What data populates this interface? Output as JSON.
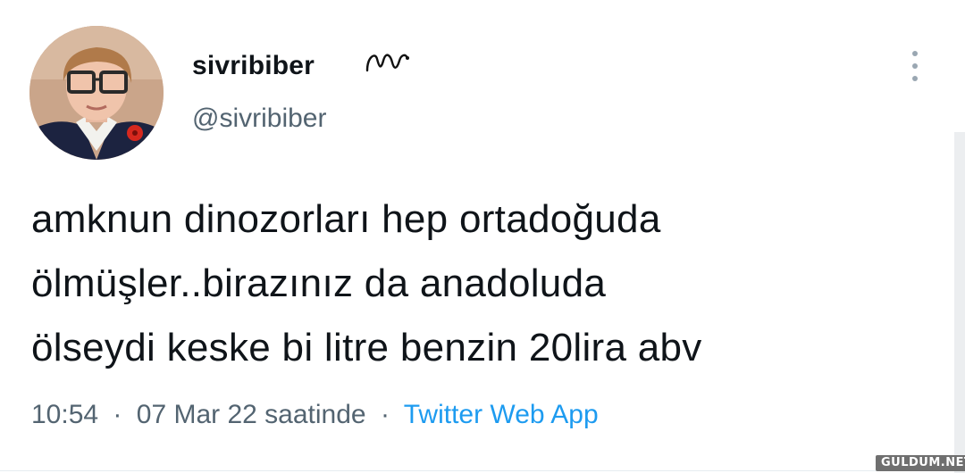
{
  "tweet": {
    "author": {
      "display_name": "sivribiber",
      "handle": "@sivribiber",
      "name_emoji": "snake-emoji"
    },
    "text_lines": [
      "amknun dinozorları hep ortadoğuda",
      "ölmüşler..birazınız da anadoluda",
      "ölseydi keske bi litre benzin 20lira abv"
    ],
    "meta": {
      "time": "10:54",
      "date_text": "07 Mar 22 saatinde",
      "separator": "·",
      "source": "Twitter Web App"
    },
    "menu_icon": "more-vertical-icon"
  },
  "watermark": "GULDUM.NET",
  "colors": {
    "text": "#0f1419",
    "secondary": "#536471",
    "link": "#1d9bf0"
  }
}
